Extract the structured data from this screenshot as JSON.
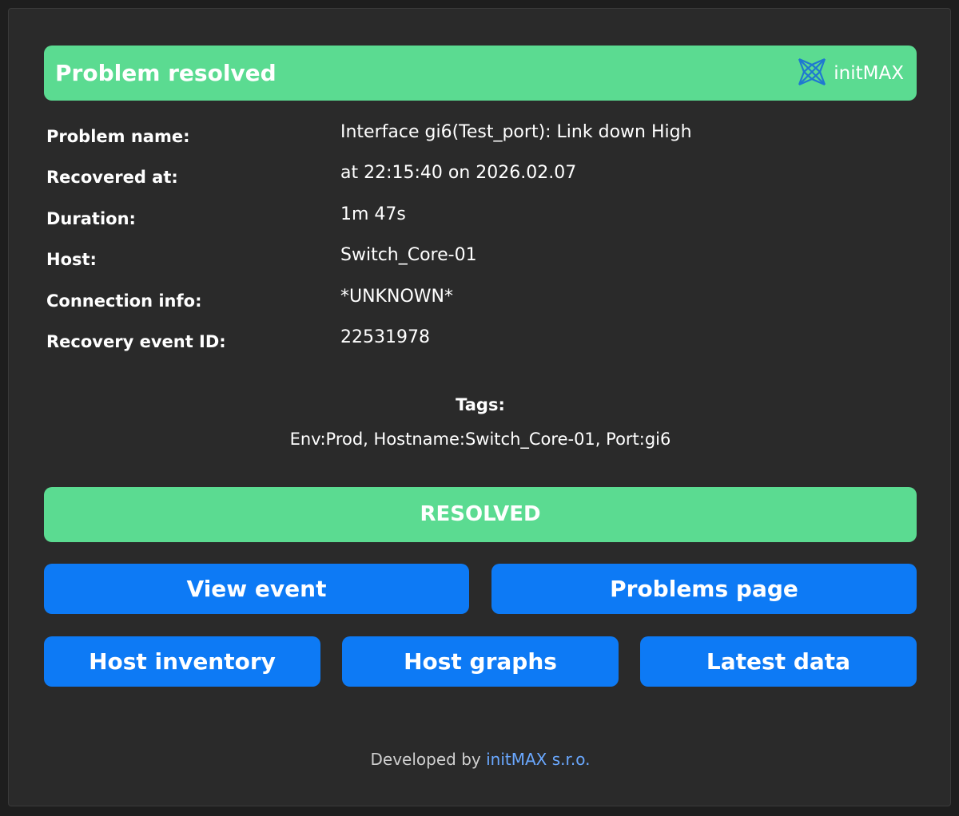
{
  "header": {
    "title": "Problem resolved",
    "brand": "initMAX",
    "brand_icon": "initmax-logo-icon",
    "color": "#5bdb91"
  },
  "details": [
    {
      "label": "Problem name:",
      "value": "Interface gi6(Test_port): Link down High"
    },
    {
      "label": "Recovered at:",
      "value": "at 22:15:40 on 2026.02.07"
    },
    {
      "label": "Duration:",
      "value": "1m 47s"
    },
    {
      "label": "Host:",
      "value": "Switch_Core-01"
    },
    {
      "label": "Connection info:",
      "value": "*UNKNOWN*"
    },
    {
      "label": "Recovery event ID:",
      "value": "22531978"
    }
  ],
  "tags": {
    "title": "Tags:",
    "value": "Env:Prod, Hostname:Switch_Core-01, Port:gi6"
  },
  "status": {
    "label": "RESOLVED",
    "color": "#5bdb91"
  },
  "buttons": {
    "view_event": "View event",
    "problems_page": "Problems page",
    "host_inventory": "Host inventory",
    "host_graphs": "Host graphs",
    "latest_data": "Latest data",
    "color": "#0d7af5"
  },
  "footer": {
    "prefix": "Developed by",
    "link": "initMAX s.r.o."
  }
}
